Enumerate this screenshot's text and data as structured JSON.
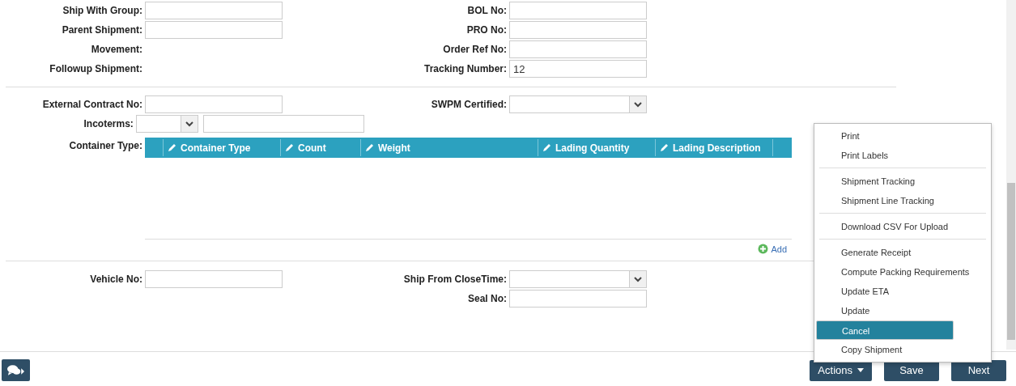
{
  "section_1": [
    {
      "left": {
        "label": "Ship With Group:",
        "kind": "input"
      },
      "right": {
        "label": "BOL No:",
        "kind": "input"
      }
    },
    {
      "left": {
        "label": "Parent Shipment:",
        "kind": "input"
      },
      "right": {
        "label": "PRO No:",
        "kind": "input"
      }
    },
    {
      "left": {
        "label": "Movement:",
        "kind": "none"
      },
      "right": {
        "label": "Order Ref No:",
        "kind": "input"
      }
    },
    {
      "left": {
        "label": "Followup Shipment:",
        "kind": "none"
      },
      "right": {
        "label": "Tracking Number:",
        "kind": "input",
        "value": "12"
      }
    }
  ],
  "section_2": [
    {
      "left": {
        "label": "External Contract No:",
        "kind": "input"
      },
      "right": {
        "label": "SWPM Certified:",
        "kind": "select"
      }
    },
    {
      "left": {
        "label": "Incoterms:",
        "kind": "combo"
      }
    }
  ],
  "container_table": {
    "label": "Container Type:",
    "columns": [
      "Container Type",
      "Count",
      "Weight",
      "Lading Quantity",
      "Lading Description"
    ],
    "add_link": "Add"
  },
  "section_3": [
    {
      "left": {
        "label": "Vehicle No:",
        "kind": "input"
      },
      "right": {
        "label": "Ship From CloseTime:",
        "kind": "select"
      }
    },
    {
      "right": {
        "label": "Seal No:",
        "kind": "input"
      }
    }
  ],
  "actions_menu": {
    "groups": [
      [
        {
          "label": "Print",
          "selected": false
        },
        {
          "label": "Print Labels",
          "selected": false
        }
      ],
      [
        {
          "label": "Shipment Tracking",
          "selected": false
        },
        {
          "label": "Shipment Line Tracking",
          "selected": false
        }
      ],
      [
        {
          "label": "Download CSV For Upload",
          "selected": false
        }
      ],
      [
        {
          "label": "Generate Receipt",
          "selected": false
        },
        {
          "label": "Compute Packing Requirements",
          "selected": false
        },
        {
          "label": "Update ETA",
          "selected": false
        },
        {
          "label": "Update",
          "selected": false
        },
        {
          "label": "Cancel",
          "selected": true
        },
        {
          "label": "Copy Shipment",
          "selected": false
        }
      ]
    ]
  },
  "footer": {
    "actions_button": "Actions",
    "save_button": "Save",
    "next_button": "Next"
  }
}
